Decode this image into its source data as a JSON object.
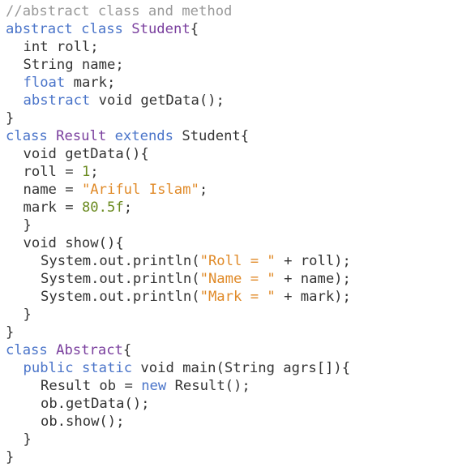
{
  "colors": {
    "background": "#ffffff",
    "plain": "#333333",
    "comment": "#999999",
    "keyword": "#4a74c9",
    "classname": "#7a3f9e",
    "string": "#e08a28",
    "number": "#6a8a1f"
  },
  "code": {
    "lines": [
      {
        "indent": 0,
        "tokens": [
          {
            "t": "//abstract class and method",
            "k": "comment"
          }
        ]
      },
      {
        "indent": 0,
        "tokens": [
          {
            "t": "abstract",
            "k": "keyword"
          },
          {
            "t": " ",
            "k": "plain"
          },
          {
            "t": "class",
            "k": "keyword"
          },
          {
            "t": " ",
            "k": "plain"
          },
          {
            "t": "Student",
            "k": "classname"
          },
          {
            "t": "{",
            "k": "plain"
          }
        ]
      },
      {
        "indent": 1,
        "tokens": [
          {
            "t": "int roll;",
            "k": "plain"
          }
        ]
      },
      {
        "indent": 1,
        "tokens": [
          {
            "t": "String name;",
            "k": "plain"
          }
        ]
      },
      {
        "indent": 1,
        "tokens": [
          {
            "t": "float",
            "k": "keyword"
          },
          {
            "t": " mark;",
            "k": "plain"
          }
        ]
      },
      {
        "indent": 1,
        "tokens": [
          {
            "t": "abstract",
            "k": "keyword"
          },
          {
            "t": " void getData();",
            "k": "plain"
          }
        ]
      },
      {
        "indent": 0,
        "tokens": [
          {
            "t": "}",
            "k": "plain"
          }
        ]
      },
      {
        "indent": 0,
        "tokens": [
          {
            "t": "class",
            "k": "keyword"
          },
          {
            "t": " ",
            "k": "plain"
          },
          {
            "t": "Result",
            "k": "classname"
          },
          {
            "t": " ",
            "k": "plain"
          },
          {
            "t": "extends",
            "k": "keyword"
          },
          {
            "t": " Student{",
            "k": "plain"
          }
        ]
      },
      {
        "indent": 1,
        "tokens": [
          {
            "t": "void getData(){",
            "k": "plain"
          }
        ]
      },
      {
        "indent": 1,
        "tokens": [
          {
            "t": "roll = ",
            "k": "plain"
          },
          {
            "t": "1",
            "k": "number"
          },
          {
            "t": ";",
            "k": "plain"
          }
        ]
      },
      {
        "indent": 1,
        "tokens": [
          {
            "t": "name = ",
            "k": "plain"
          },
          {
            "t": "\"Ariful Islam\"",
            "k": "string"
          },
          {
            "t": ";",
            "k": "plain"
          }
        ]
      },
      {
        "indent": 1,
        "tokens": [
          {
            "t": "mark = ",
            "k": "plain"
          },
          {
            "t": "80.5f",
            "k": "number"
          },
          {
            "t": ";",
            "k": "plain"
          }
        ]
      },
      {
        "indent": 1,
        "tokens": [
          {
            "t": "}",
            "k": "plain"
          }
        ]
      },
      {
        "indent": 1,
        "tokens": [
          {
            "t": "void show(){",
            "k": "plain"
          }
        ]
      },
      {
        "indent": 2,
        "tokens": [
          {
            "t": "System.out.println(",
            "k": "plain"
          },
          {
            "t": "\"Roll = \"",
            "k": "string"
          },
          {
            "t": " + roll);",
            "k": "plain"
          }
        ]
      },
      {
        "indent": 2,
        "tokens": [
          {
            "t": "System.out.println(",
            "k": "plain"
          },
          {
            "t": "\"Name = \"",
            "k": "string"
          },
          {
            "t": " + name);",
            "k": "plain"
          }
        ]
      },
      {
        "indent": 2,
        "tokens": [
          {
            "t": "System.out.println(",
            "k": "plain"
          },
          {
            "t": "\"Mark = \"",
            "k": "string"
          },
          {
            "t": " + mark);",
            "k": "plain"
          }
        ]
      },
      {
        "indent": 1,
        "tokens": [
          {
            "t": "}",
            "k": "plain"
          }
        ]
      },
      {
        "indent": 0,
        "tokens": [
          {
            "t": "}",
            "k": "plain"
          }
        ]
      },
      {
        "indent": 0,
        "tokens": [
          {
            "t": "class",
            "k": "keyword"
          },
          {
            "t": " ",
            "k": "plain"
          },
          {
            "t": "Abstract",
            "k": "classname"
          },
          {
            "t": "{",
            "k": "plain"
          }
        ]
      },
      {
        "indent": 1,
        "tokens": [
          {
            "t": "public",
            "k": "keyword"
          },
          {
            "t": " ",
            "k": "plain"
          },
          {
            "t": "static",
            "k": "keyword"
          },
          {
            "t": " void main(String agrs[]){",
            "k": "plain"
          }
        ]
      },
      {
        "indent": 2,
        "tokens": [
          {
            "t": "Result ob = ",
            "k": "plain"
          },
          {
            "t": "new",
            "k": "keyword"
          },
          {
            "t": " Result();",
            "k": "plain"
          }
        ]
      },
      {
        "indent": 2,
        "tokens": [
          {
            "t": "ob.getData();",
            "k": "plain"
          }
        ]
      },
      {
        "indent": 2,
        "tokens": [
          {
            "t": "ob.show();",
            "k": "plain"
          }
        ]
      },
      {
        "indent": 1,
        "tokens": [
          {
            "t": "}",
            "k": "plain"
          }
        ]
      },
      {
        "indent": 0,
        "tokens": [
          {
            "t": "}",
            "k": "plain"
          }
        ]
      }
    ]
  }
}
